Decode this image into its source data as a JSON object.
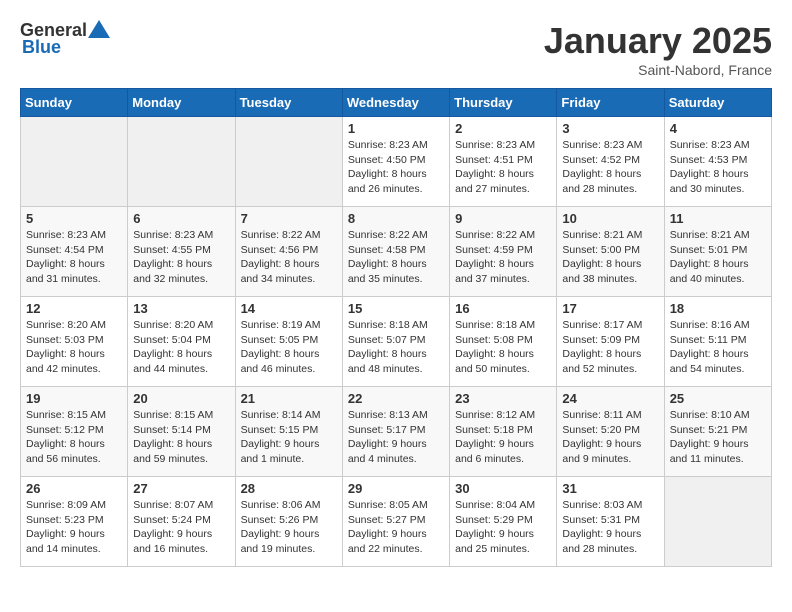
{
  "header": {
    "logo_general": "General",
    "logo_blue": "Blue",
    "month": "January 2025",
    "location": "Saint-Nabord, France"
  },
  "weekdays": [
    "Sunday",
    "Monday",
    "Tuesday",
    "Wednesday",
    "Thursday",
    "Friday",
    "Saturday"
  ],
  "weeks": [
    [
      {
        "day": "",
        "info": ""
      },
      {
        "day": "",
        "info": ""
      },
      {
        "day": "",
        "info": ""
      },
      {
        "day": "1",
        "info": "Sunrise: 8:23 AM\nSunset: 4:50 PM\nDaylight: 8 hours and 26 minutes."
      },
      {
        "day": "2",
        "info": "Sunrise: 8:23 AM\nSunset: 4:51 PM\nDaylight: 8 hours and 27 minutes."
      },
      {
        "day": "3",
        "info": "Sunrise: 8:23 AM\nSunset: 4:52 PM\nDaylight: 8 hours and 28 minutes."
      },
      {
        "day": "4",
        "info": "Sunrise: 8:23 AM\nSunset: 4:53 PM\nDaylight: 8 hours and 30 minutes."
      }
    ],
    [
      {
        "day": "5",
        "info": "Sunrise: 8:23 AM\nSunset: 4:54 PM\nDaylight: 8 hours and 31 minutes."
      },
      {
        "day": "6",
        "info": "Sunrise: 8:23 AM\nSunset: 4:55 PM\nDaylight: 8 hours and 32 minutes."
      },
      {
        "day": "7",
        "info": "Sunrise: 8:22 AM\nSunset: 4:56 PM\nDaylight: 8 hours and 34 minutes."
      },
      {
        "day": "8",
        "info": "Sunrise: 8:22 AM\nSunset: 4:58 PM\nDaylight: 8 hours and 35 minutes."
      },
      {
        "day": "9",
        "info": "Sunrise: 8:22 AM\nSunset: 4:59 PM\nDaylight: 8 hours and 37 minutes."
      },
      {
        "day": "10",
        "info": "Sunrise: 8:21 AM\nSunset: 5:00 PM\nDaylight: 8 hours and 38 minutes."
      },
      {
        "day": "11",
        "info": "Sunrise: 8:21 AM\nSunset: 5:01 PM\nDaylight: 8 hours and 40 minutes."
      }
    ],
    [
      {
        "day": "12",
        "info": "Sunrise: 8:20 AM\nSunset: 5:03 PM\nDaylight: 8 hours and 42 minutes."
      },
      {
        "day": "13",
        "info": "Sunrise: 8:20 AM\nSunset: 5:04 PM\nDaylight: 8 hours and 44 minutes."
      },
      {
        "day": "14",
        "info": "Sunrise: 8:19 AM\nSunset: 5:05 PM\nDaylight: 8 hours and 46 minutes."
      },
      {
        "day": "15",
        "info": "Sunrise: 8:18 AM\nSunset: 5:07 PM\nDaylight: 8 hours and 48 minutes."
      },
      {
        "day": "16",
        "info": "Sunrise: 8:18 AM\nSunset: 5:08 PM\nDaylight: 8 hours and 50 minutes."
      },
      {
        "day": "17",
        "info": "Sunrise: 8:17 AM\nSunset: 5:09 PM\nDaylight: 8 hours and 52 minutes."
      },
      {
        "day": "18",
        "info": "Sunrise: 8:16 AM\nSunset: 5:11 PM\nDaylight: 8 hours and 54 minutes."
      }
    ],
    [
      {
        "day": "19",
        "info": "Sunrise: 8:15 AM\nSunset: 5:12 PM\nDaylight: 8 hours and 56 minutes."
      },
      {
        "day": "20",
        "info": "Sunrise: 8:15 AM\nSunset: 5:14 PM\nDaylight: 8 hours and 59 minutes."
      },
      {
        "day": "21",
        "info": "Sunrise: 8:14 AM\nSunset: 5:15 PM\nDaylight: 9 hours and 1 minute."
      },
      {
        "day": "22",
        "info": "Sunrise: 8:13 AM\nSunset: 5:17 PM\nDaylight: 9 hours and 4 minutes."
      },
      {
        "day": "23",
        "info": "Sunrise: 8:12 AM\nSunset: 5:18 PM\nDaylight: 9 hours and 6 minutes."
      },
      {
        "day": "24",
        "info": "Sunrise: 8:11 AM\nSunset: 5:20 PM\nDaylight: 9 hours and 9 minutes."
      },
      {
        "day": "25",
        "info": "Sunrise: 8:10 AM\nSunset: 5:21 PM\nDaylight: 9 hours and 11 minutes."
      }
    ],
    [
      {
        "day": "26",
        "info": "Sunrise: 8:09 AM\nSunset: 5:23 PM\nDaylight: 9 hours and 14 minutes."
      },
      {
        "day": "27",
        "info": "Sunrise: 8:07 AM\nSunset: 5:24 PM\nDaylight: 9 hours and 16 minutes."
      },
      {
        "day": "28",
        "info": "Sunrise: 8:06 AM\nSunset: 5:26 PM\nDaylight: 9 hours and 19 minutes."
      },
      {
        "day": "29",
        "info": "Sunrise: 8:05 AM\nSunset: 5:27 PM\nDaylight: 9 hours and 22 minutes."
      },
      {
        "day": "30",
        "info": "Sunrise: 8:04 AM\nSunset: 5:29 PM\nDaylight: 9 hours and 25 minutes."
      },
      {
        "day": "31",
        "info": "Sunrise: 8:03 AM\nSunset: 5:31 PM\nDaylight: 9 hours and 28 minutes."
      },
      {
        "day": "",
        "info": ""
      }
    ]
  ]
}
